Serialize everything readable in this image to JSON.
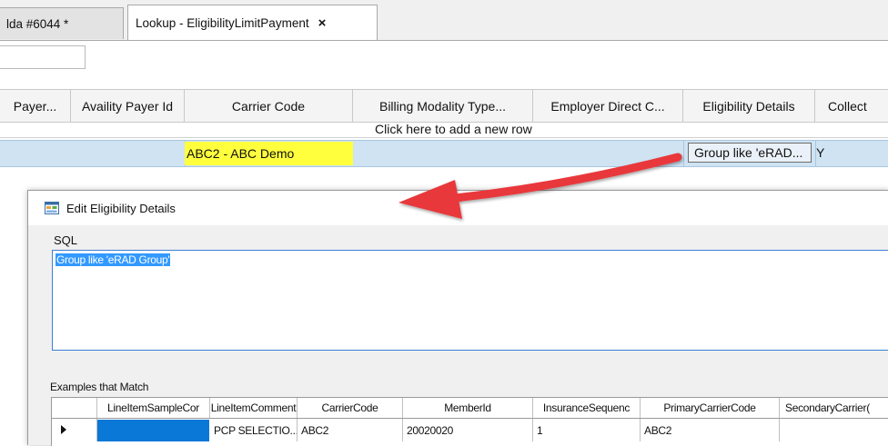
{
  "tabs": [
    {
      "label": "lda #6044 *"
    },
    {
      "label": "Lookup - EligibilityLimitPayment",
      "close_label": "×"
    }
  ],
  "grid": {
    "columns": [
      "Payer...",
      "Availity Payer Id",
      "Carrier Code",
      "Billing  Modality  Type...",
      "Employer  Direct  C...",
      "Eligibility  Details",
      "Collect"
    ],
    "add_row_text": "Click here to add a new row",
    "row": {
      "carrier_code": "ABC2 - ABC Demo",
      "eligibility_details": "Group  like  'eRAD...",
      "collect": "Y"
    }
  },
  "dialog": {
    "title": "Edit Eligibility Details",
    "sql_label": "SQL",
    "sql_value": "Group like 'eRAD Group'",
    "examples_label": "Examples that Match",
    "examples": {
      "columns": [
        "LineItemSampleCor",
        "LineItemComment",
        "CarrierCode",
        "MemberId",
        "InsuranceSequenc",
        "PrimaryCarrierCode",
        "SecondaryCarrier("
      ],
      "rows": [
        [
          "",
          "PCP SELECTIO...",
          "ABC2",
          "20020020",
          "1",
          "ABC2",
          ""
        ]
      ]
    }
  },
  "colors": {
    "highlight_yellow": "#ffff3d",
    "selected_row": "#cfe3f3",
    "selection_blue": "#3399ff",
    "arrow_red": "#e8383b"
  },
  "icons": {
    "dialog_icon": "form-window-icon",
    "row_indicator": "row-pointer-icon"
  }
}
